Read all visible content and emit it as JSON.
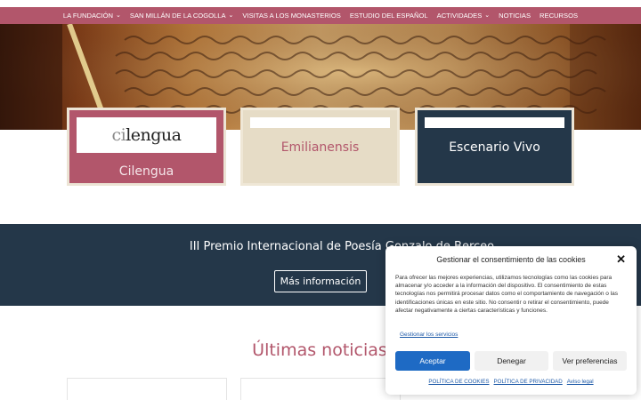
{
  "nav": {
    "items": [
      {
        "label": "LA FUNDACIÓN",
        "dropdown": true
      },
      {
        "label": "SAN MILLÁN DE LA COGOLLA",
        "dropdown": true
      },
      {
        "label": "VISITAS A LOS MONASTERIOS",
        "dropdown": false
      },
      {
        "label": "ESTUDIO DEL ESPAÑOL",
        "dropdown": false
      },
      {
        "label": "ACTIVIDADES",
        "dropdown": true
      },
      {
        "label": "NOTICIAS",
        "dropdown": false
      },
      {
        "label": "RECURSOS",
        "dropdown": false
      }
    ],
    "chevron": "⌄"
  },
  "cards": {
    "cilengua": {
      "label": "Cilengua",
      "logo_prefix": "ci",
      "logo_main": "lengua"
    },
    "emilianensis": {
      "label": "Emilianensis"
    },
    "escenario": {
      "label": "Escenario Vivo"
    }
  },
  "band": {
    "title": "III Premio Internacional de Poesía Gonzalo de Berceo",
    "button": "Más información"
  },
  "news": {
    "title": "Últimas noticias"
  },
  "cookie": {
    "title": "Gestionar el consentimiento de las cookies",
    "close": "✕",
    "text": "Para ofrecer las mejores experiencias, utilizamos tecnologías como las cookies para almacenar y/o acceder a la información del dispositivo. El consentimiento de estas tecnologías nos permitirá procesar datos como el comportamiento de navegación o las identificaciones únicas en este sitio. No consentir o retirar el consentimiento, puede afectar negativamente a ciertas características y funciones.",
    "manage": "Gestionar los servicios",
    "accept": "Aceptar",
    "deny": "Denegar",
    "preferences": "Ver preferencias",
    "links": [
      "POLÍTICA DE COOKIES",
      "POLÍTICA DE PRIVACIDAD",
      "Aviso legal"
    ]
  },
  "colors": {
    "accent": "#b2566b",
    "navy": "#243749",
    "beige": "#e6dcc6",
    "button_blue": "#1e6ac4"
  }
}
